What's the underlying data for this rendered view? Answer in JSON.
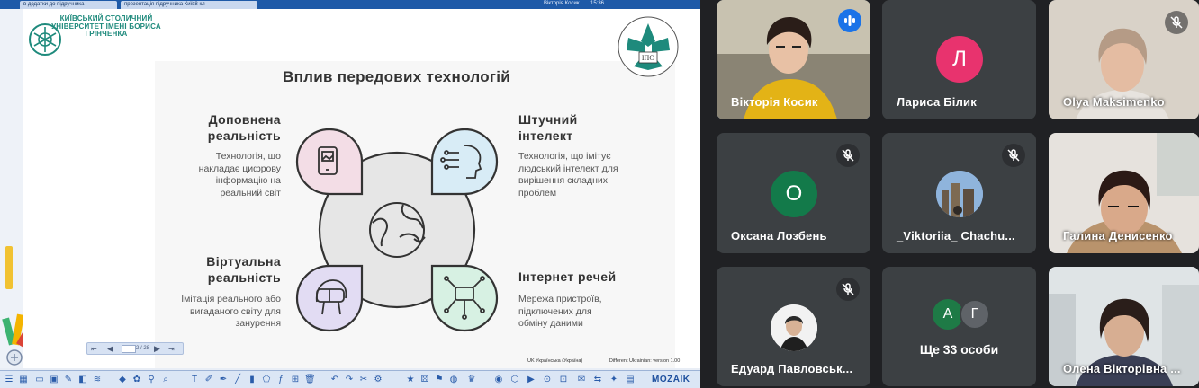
{
  "browser": {
    "tab1": "в додатки до підручника",
    "tab2": "презентація підручника Київ8 кл",
    "presenter_label": "Вікторія Косик",
    "clock": "15:36"
  },
  "slide": {
    "university": "КИЇВСЬКИЙ СТОЛИЧНИЙ УНІВЕРСИТЕТ ІМЕНІ БОРИСА ГРІНЧЕНКА",
    "seal_text": "ІНСТИТУТ ПІСЛЯДИПЛОМНОЇ ОСВІТИ",
    "seal_abbr": "ІПО",
    "title": "Вплив передових технологій",
    "quadrants": [
      {
        "heading": "Доповнена реальність",
        "text": "Технологія, що накладає цифрову інформацію на реальний світ",
        "icon": "smartphone-icon",
        "color": "#f3dde6"
      },
      {
        "heading": "Штучний інтелект",
        "text": "Технологія, що імітує людський інтелект для вирішення складних проблем",
        "icon": "ai-head-icon",
        "color": "#d8ecf6"
      },
      {
        "heading": "Віртуальна реальність",
        "text": "Імітація реального або вигаданого світу для занурення",
        "icon": "vr-headset-icon",
        "color": "#e2dcf3"
      },
      {
        "heading": "Інтернет речей",
        "text": "Мережа пристроїв, підключених для обміну даними",
        "icon": "iot-network-icon",
        "color": "#d7f1e3"
      }
    ],
    "center_icon": "globe-refresh-icon",
    "page_indicator": "2 / 28",
    "status_language": "UK Українська (Україна)",
    "status_version": "Different Ukrainian: version 1.00"
  },
  "toolbar": {
    "brand": "MOZAIK"
  },
  "participants": [
    {
      "name": "Вікторія Косик",
      "state": "speaking",
      "avatar_letter": "",
      "avatar_color": "#c9a227"
    },
    {
      "name": "Лариса Білик",
      "state": "none",
      "avatar_letter": "Л",
      "avatar_color": "#e8336e"
    },
    {
      "name": "Olya Maksimenko",
      "state": "muted",
      "avatar_letter": "",
      "avatar_color": ""
    },
    {
      "name": "Оксана Лозбень",
      "state": "muted",
      "avatar_letter": "О",
      "avatar_color": "#137a4a"
    },
    {
      "name": "_Viktoriia_ Chachu...",
      "state": "muted",
      "avatar_letter": "",
      "avatar_color": "#6b8bb8"
    },
    {
      "name": "Галина Денисенко",
      "state": "none",
      "avatar_letter": "",
      "avatar_color": ""
    },
    {
      "name": "Едуард Павловськ...",
      "state": "muted",
      "avatar_letter": "",
      "avatar_color": "#2b2b2b"
    },
    {
      "name": "Ще 33 особи",
      "state": "none",
      "avatar_letter": "",
      "avatar_color": ""
    },
    {
      "name": "Олена Вікторівна ...",
      "state": "none",
      "avatar_letter": "",
      "avatar_color": ""
    }
  ],
  "more_avatars": [
    {
      "letter": "А",
      "color": "#1e7a46"
    },
    {
      "letter": "Г",
      "color": "#5f6368"
    }
  ]
}
